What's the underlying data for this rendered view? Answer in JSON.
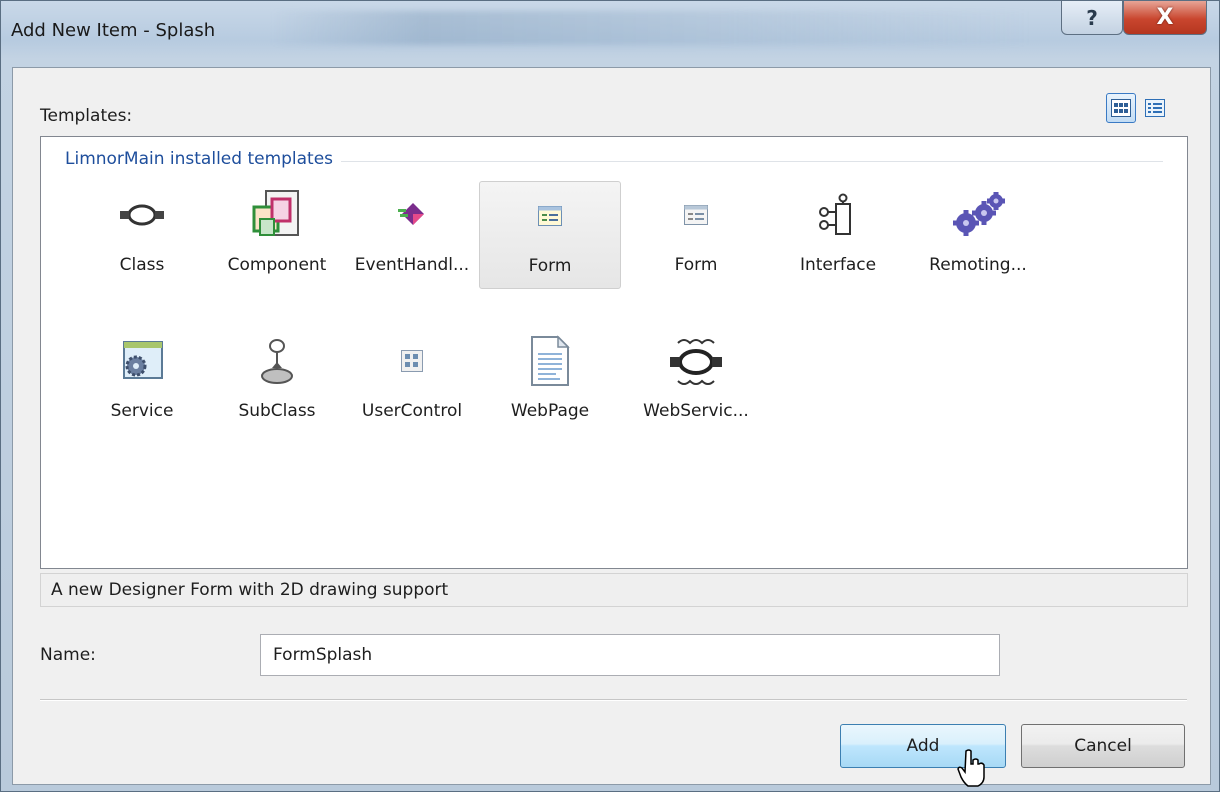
{
  "window": {
    "title": "Add New Item - Splash",
    "help_glyph": "?",
    "close_glyph": "X"
  },
  "templates_label": "Templates:",
  "view_modes": [
    "large-icons-view-icon",
    "small-icons-view-icon"
  ],
  "group_header": "LimnorMain installed templates",
  "templates": [
    {
      "label": "Class",
      "icon": "class-icon"
    },
    {
      "label": "Component",
      "icon": "component-icon"
    },
    {
      "label": "EventHandl...",
      "icon": "event-handler-icon"
    },
    {
      "label": "Form",
      "icon": "form-icon",
      "selected": true
    },
    {
      "label": "Form",
      "icon": "form-icon"
    },
    {
      "label": "Interface",
      "icon": "interface-icon"
    },
    {
      "label": "Remoting...",
      "icon": "remoting-gears-icon"
    },
    {
      "label": "Service",
      "icon": "service-icon"
    },
    {
      "label": "SubClass",
      "icon": "subclass-icon"
    },
    {
      "label": "UserControl",
      "icon": "user-control-icon"
    },
    {
      "label": "WebPage",
      "icon": "web-page-icon"
    },
    {
      "label": "WebServic...",
      "icon": "web-service-icon"
    }
  ],
  "description": "A new Designer Form with 2D drawing support",
  "name_label": "Name:",
  "name_value": "FormSplash",
  "buttons": {
    "add": "Add",
    "cancel": "Cancel"
  },
  "colors": {
    "group_header": "#1e4e9c",
    "close_button": "#c9462e",
    "selection": "#e6e6e6"
  }
}
